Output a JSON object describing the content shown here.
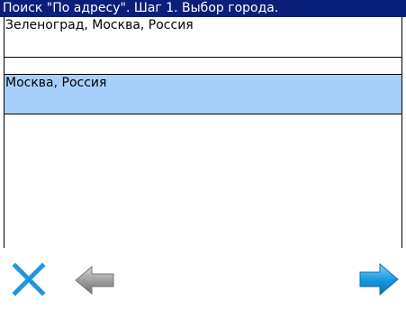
{
  "window": {
    "title": "Поиск \"По адресу\". Шаг 1. Выбор города."
  },
  "city_list": {
    "items": [
      {
        "label": "Зеленоград, Москва, Россия",
        "selected": false
      },
      {
        "label": "Москва, Россия",
        "selected": true
      }
    ]
  },
  "toolbar": {
    "cancel_icon": "close-x-icon",
    "back_icon": "arrow-left-icon",
    "next_icon": "arrow-right-icon"
  },
  "colors": {
    "title_bg": "#0a1f7a",
    "selection": "#a6d0fb",
    "cancel": "#2196e0",
    "next": "#1a9be0",
    "back": "#9a9a9a"
  }
}
